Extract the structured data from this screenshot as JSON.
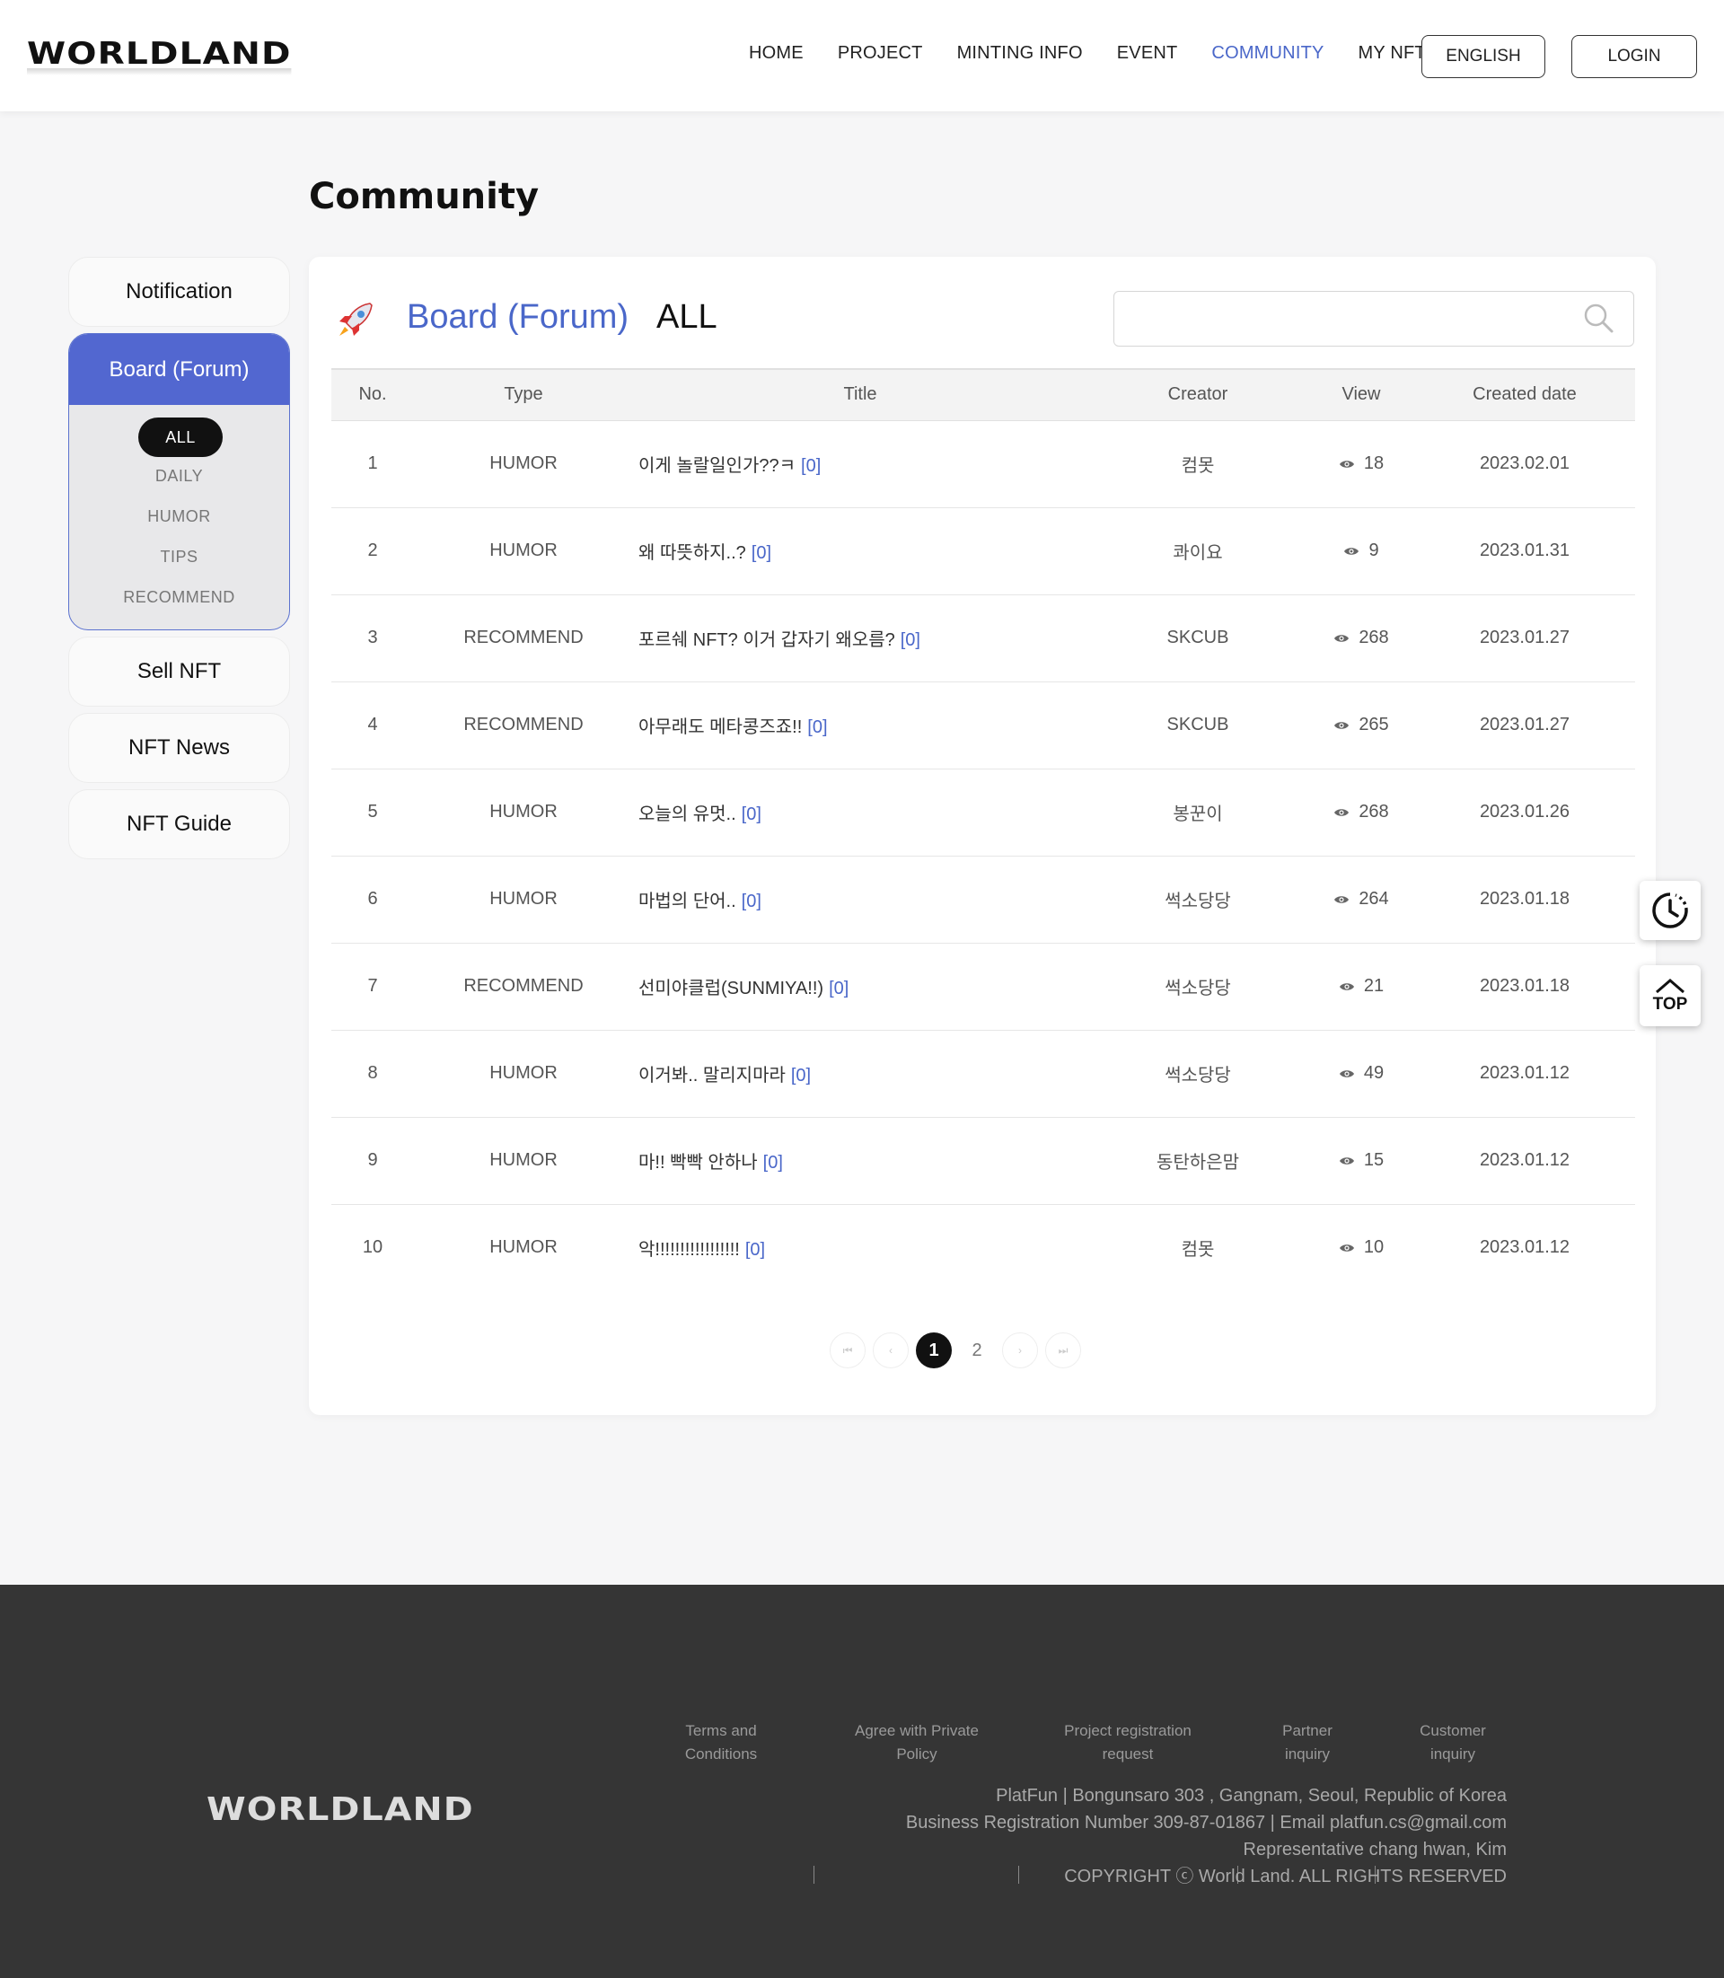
{
  "header": {
    "logo": "WORLDLAND",
    "nav": [
      "HOME",
      "PROJECT",
      "MINTING INFO",
      "EVENT",
      "COMMUNITY",
      "MY NFT"
    ],
    "lang_button": "ENGLISH",
    "login_button": "LOGIN"
  },
  "page_title": "Community",
  "sidebar": {
    "notification": "Notification",
    "board": "Board (Forum)",
    "board_subs": [
      "ALL",
      "DAILY",
      "HUMOR",
      "TIPS",
      "RECOMMEND"
    ],
    "sell_nft": "Sell NFT",
    "nft_news": "NFT News",
    "nft_guide": "NFT Guide"
  },
  "board": {
    "title": "Board (Forum)",
    "category": "ALL",
    "search_placeholder": "",
    "columns": [
      "No.",
      "Type",
      "Title",
      "Creator",
      "View",
      "Created date"
    ],
    "rows": [
      {
        "no": "1",
        "type": "HUMOR",
        "title": "이게 놀랄일인가??ㅋ",
        "comments": "[0]",
        "creator": "컴못",
        "views": "18",
        "date": "2023.02.01"
      },
      {
        "no": "2",
        "type": "HUMOR",
        "title": "왜 따뜻하지..?",
        "comments": "[0]",
        "creator": "콰이요",
        "views": "9",
        "date": "2023.01.31"
      },
      {
        "no": "3",
        "type": "RECOMMEND",
        "title": "포르쉐 NFT? 이거 갑자기 왜오름?",
        "comments": "[0]",
        "creator": "SKCUB",
        "views": "268",
        "date": "2023.01.27"
      },
      {
        "no": "4",
        "type": "RECOMMEND",
        "title": "아무래도 메타콩즈죠!!",
        "comments": "[0]",
        "creator": "SKCUB",
        "views": "265",
        "date": "2023.01.27"
      },
      {
        "no": "5",
        "type": "HUMOR",
        "title": "오늘의 유멋..",
        "comments": "[0]",
        "creator": "봉꾼이",
        "views": "268",
        "date": "2023.01.26"
      },
      {
        "no": "6",
        "type": "HUMOR",
        "title": "마법의 단어..",
        "comments": "[0]",
        "creator": "썩소당당",
        "views": "264",
        "date": "2023.01.18"
      },
      {
        "no": "7",
        "type": "RECOMMEND",
        "title": "선미야클럽(SUNMIYA!!)",
        "comments": "[0]",
        "creator": "썩소당당",
        "views": "21",
        "date": "2023.01.18"
      },
      {
        "no": "8",
        "type": "HUMOR",
        "title": "이거봐.. 말리지마라",
        "comments": "[0]",
        "creator": "썩소당당",
        "views": "49",
        "date": "2023.01.12"
      },
      {
        "no": "9",
        "type": "HUMOR",
        "title": "마!! 빡빡 안하나",
        "comments": "[0]",
        "creator": "동탄하은맘",
        "views": "15",
        "date": "2023.01.12"
      },
      {
        "no": "10",
        "type": "HUMOR",
        "title": "악!!!!!!!!!!!!!!!!!",
        "comments": "[0]",
        "creator": "컴못",
        "views": "10",
        "date": "2023.01.12"
      }
    ]
  },
  "pagination": {
    "first": "⏮",
    "prev": "‹",
    "pages": [
      "1",
      "2"
    ],
    "current": "1",
    "next": "›",
    "last": "⏭"
  },
  "floating": {
    "top_label": "TOP"
  },
  "footer": {
    "logo": "WORLDLAND",
    "links": [
      [
        "Terms and",
        "Conditions"
      ],
      [
        "Agree with Private",
        "Policy"
      ],
      [
        "Project registration",
        "request"
      ],
      [
        "Partner",
        "inquiry"
      ],
      [
        "Customer",
        "inquiry"
      ]
    ],
    "info": [
      "PlatFun | Bongunsaro 303 , Gangnam, Seoul, Republic of Korea",
      "Business Registration Number 309-87-01867 | Email platfun.cs@gmail.com",
      "Representative chang hwan, Kim",
      "COPYRIGHT ⓒ World Land. ALL RIGHTS RESERVED"
    ]
  },
  "colors": {
    "accent": "#4a67c9",
    "sidebar_active": "#5267d0",
    "footer_bg": "#353535"
  }
}
